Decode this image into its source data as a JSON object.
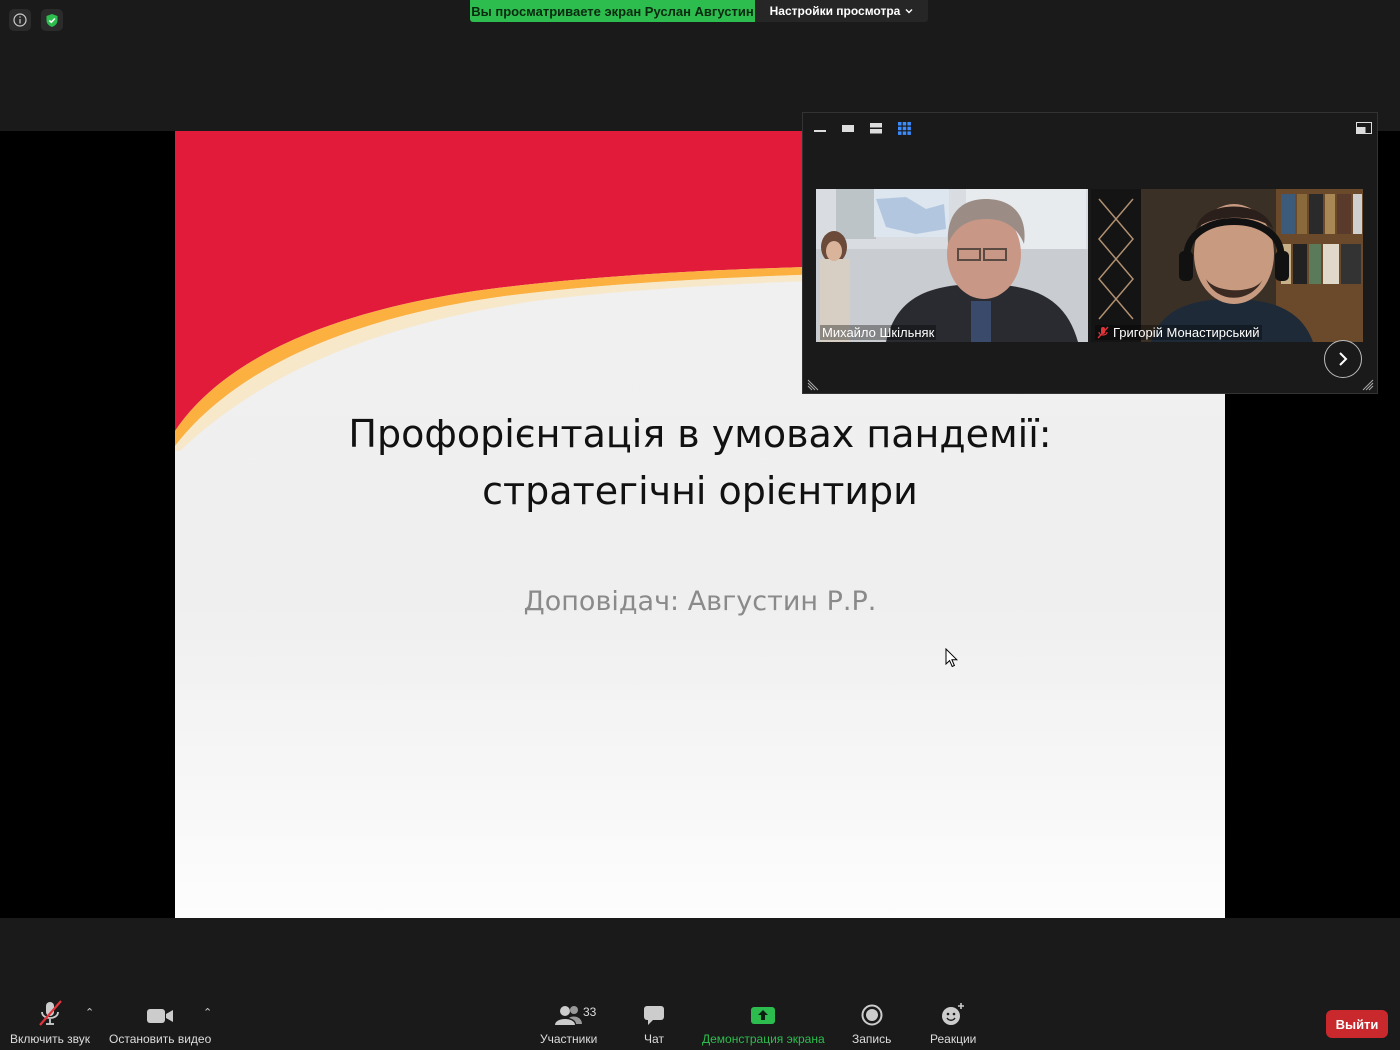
{
  "top_bar": {
    "share_banner": "Вы просматриваете экран Руслан Августин",
    "view_options_label": "Настройки просмотра"
  },
  "slide": {
    "title_line1": "Профорієнтація в умовах пандемії:",
    "title_line2": "стратегічні орієнтири",
    "subtitle": "Доповідач: Августин Р.Р.",
    "colors": {
      "red": "#e31b3b",
      "orange": "#fbb040"
    }
  },
  "video_panel": {
    "participants": [
      {
        "name": "Михайло Шкільняк",
        "muted": false
      },
      {
        "name": "Григорій Монастирський",
        "muted": true
      }
    ]
  },
  "toolbar": {
    "unmute_label": "Включить звук",
    "stop_video_label": "Остановить видео",
    "participants_label": "Участники",
    "participants_count": "33",
    "chat_label": "Чат",
    "share_screen_label": "Демонстрация экрана",
    "record_label": "Запись",
    "reactions_label": "Реакции",
    "leave_label": "Выйти"
  },
  "colors": {
    "accent_green": "#2dbc4e",
    "leave_red": "#c9282d",
    "muted_red": "#e0343a"
  }
}
